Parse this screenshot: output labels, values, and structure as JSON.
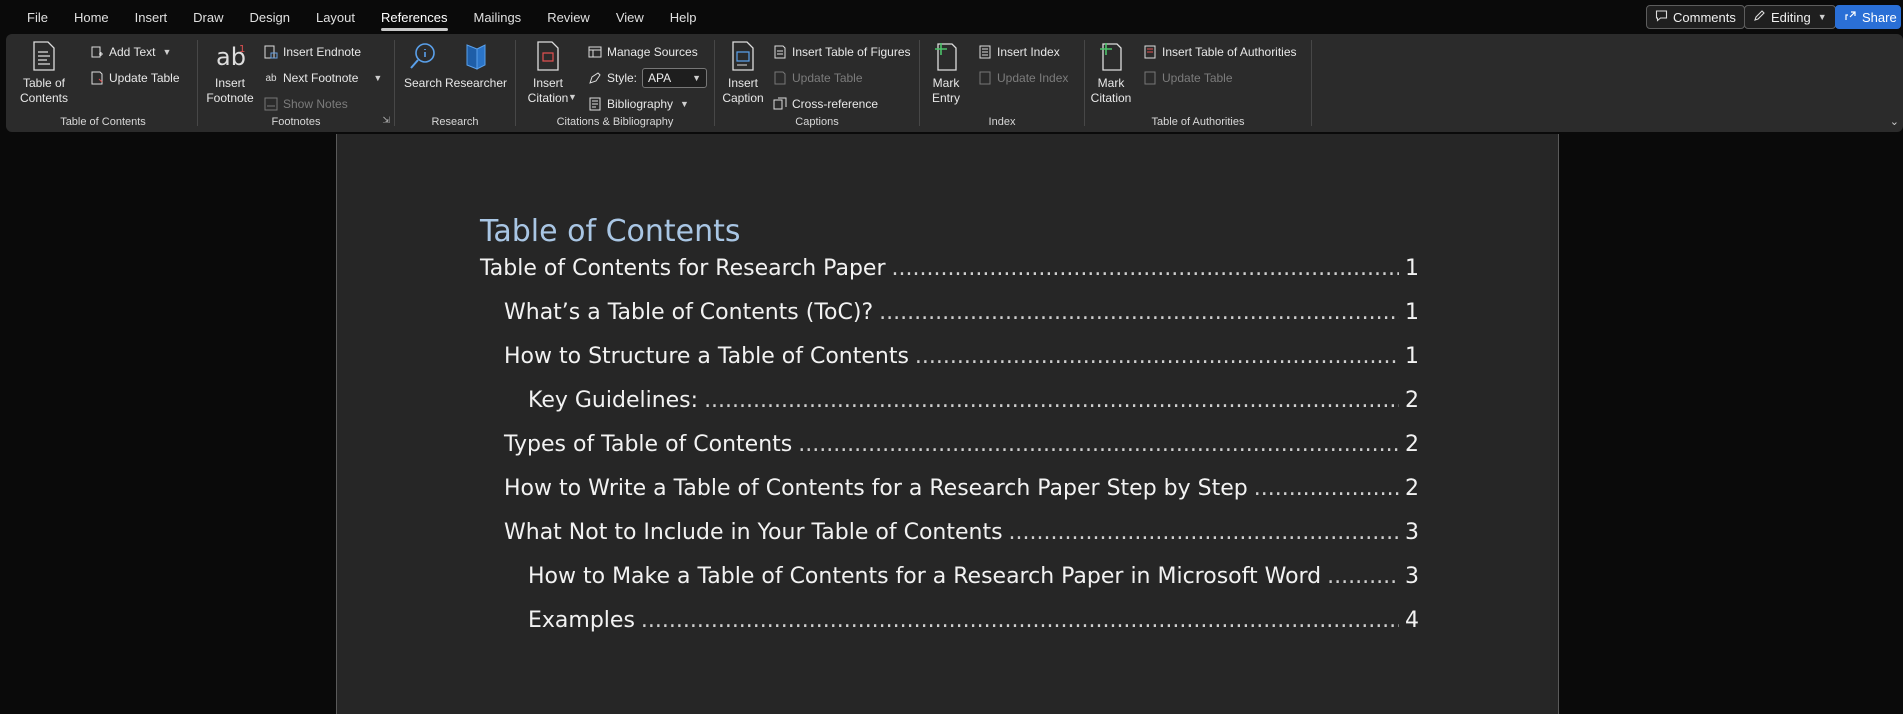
{
  "menu": {
    "tabs": [
      "File",
      "Home",
      "Insert",
      "Draw",
      "Design",
      "Layout",
      "References",
      "Mailings",
      "Review",
      "View",
      "Help"
    ],
    "active": "References",
    "comments": "Comments",
    "editing": "Editing",
    "share": "Share"
  },
  "ribbon": {
    "toc": {
      "label": "Table of Contents",
      "big": "Table of Contents",
      "add_text": "Add Text",
      "update_table": "Update Table"
    },
    "footnotes": {
      "label": "Footnotes",
      "insert_footnote": "Insert Footnote",
      "insert_endnote": "Insert Endnote",
      "next_footnote": "Next Footnote",
      "show_notes": "Show Notes"
    },
    "research": {
      "label": "Research",
      "search": "Search",
      "researcher": "Researcher"
    },
    "citations": {
      "label": "Citations & Bibliography",
      "insert_citation": "Insert Citation",
      "manage_sources": "Manage Sources",
      "style_label": "Style:",
      "style_value": "APA",
      "bibliography": "Bibliography"
    },
    "captions": {
      "label": "Captions",
      "insert_caption": "Insert Caption",
      "insert_tof": "Insert Table of Figures",
      "update_table": "Update Table",
      "cross_reference": "Cross-reference"
    },
    "index": {
      "label": "Index",
      "mark_entry": "Mark Entry",
      "insert_index": "Insert Index",
      "update_index": "Update Index"
    },
    "toa": {
      "label": "Table of Authorities",
      "mark_citation": "Mark Citation",
      "insert_toa": "Insert Table of Authorities",
      "update_table": "Update Table"
    }
  },
  "document": {
    "toc_title": "Table of Contents",
    "entries": [
      {
        "text": "Table of Contents for Research Paper",
        "page": "1",
        "level": 1
      },
      {
        "text": "What’s a Table of Contents (ToC)?",
        "page": "1",
        "level": 2
      },
      {
        "text": "How to Structure a Table of Contents",
        "page": "1",
        "level": 2
      },
      {
        "text": "Key Guidelines:",
        "page": "2",
        "level": 3
      },
      {
        "text": "Types of Table of Contents",
        "page": "2",
        "level": 2
      },
      {
        "text": "How to Write a Table of Contents for a Research Paper Step by Step",
        "page": "2",
        "level": 2
      },
      {
        "text": "What Not to Include in Your Table of Contents",
        "page": "3",
        "level": 2
      },
      {
        "text": "How to Make a Table of Contents for a Research Paper in Microsoft Word",
        "page": "3",
        "level": 3
      },
      {
        "text": "Examples",
        "page": "4",
        "level": 3
      }
    ]
  }
}
